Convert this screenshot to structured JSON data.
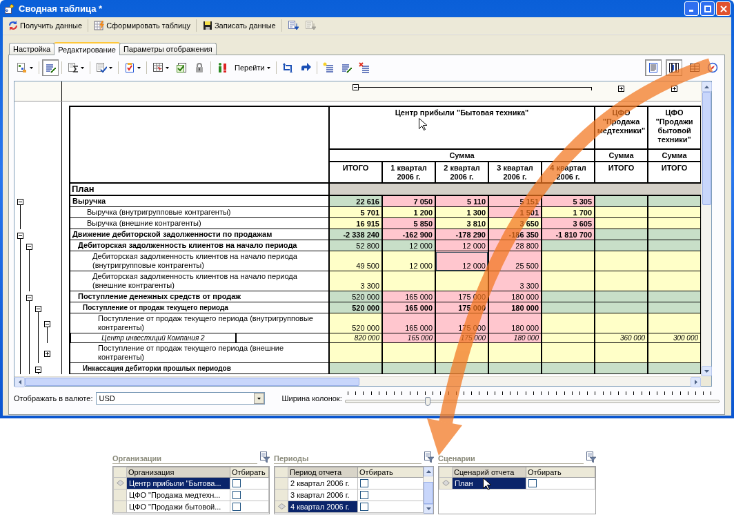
{
  "window": {
    "title": "Сводная таблица *"
  },
  "commands": [
    {
      "kind": "button",
      "label": "Получить данные"
    },
    {
      "kind": "button",
      "label": "Сформировать таблицу"
    },
    {
      "kind": "button",
      "label": "Записать данные"
    },
    {
      "kind": "icon",
      "disabled": false
    },
    {
      "kind": "icon",
      "disabled": true
    }
  ],
  "tabs": [
    {
      "label": "Настройка",
      "selected": false
    },
    {
      "label": "Редактирование",
      "selected": true
    },
    {
      "label": "Параметры отображения",
      "selected": false
    }
  ],
  "toolbar": [
    {
      "kind": "icon",
      "dropdown": true,
      "pressed": false
    },
    {
      "kind": "separator"
    },
    {
      "kind": "icon",
      "dropdown": false,
      "pressed": true
    },
    {
      "kind": "separator"
    },
    {
      "kind": "icon",
      "dropdown": true,
      "pressed": false
    },
    {
      "kind": "separator"
    },
    {
      "kind": "icon",
      "dropdown": true,
      "pressed": false
    },
    {
      "kind": "separator"
    },
    {
      "kind": "icon",
      "dropdown": true,
      "pressed": false
    },
    {
      "kind": "separator"
    },
    {
      "kind": "icon",
      "dropdown": true,
      "pressed": false
    },
    {
      "kind": "icon",
      "dropdown": false,
      "pressed": false
    },
    {
      "kind": "icon",
      "dropdown": false,
      "pressed": false
    },
    {
      "kind": "separator"
    },
    {
      "kind": "icon",
      "dropdown": false,
      "pressed": false
    },
    {
      "kind": "menu",
      "label": "Перейти"
    },
    {
      "kind": "separator"
    },
    {
      "kind": "icon",
      "dropdown": false,
      "pressed": false
    },
    {
      "kind": "icon",
      "dropdown": false,
      "pressed": false
    },
    {
      "kind": "separator"
    },
    {
      "kind": "icon",
      "dropdown": false,
      "pressed": false
    },
    {
      "kind": "icon",
      "dropdown": false,
      "pressed": false
    },
    {
      "kind": "icon",
      "dropdown": false,
      "pressed": false
    }
  ],
  "view_buttons": [
    {
      "pressed": true
    },
    {
      "pressed": true
    },
    {
      "pressed": false
    }
  ],
  "grid": {
    "header": {
      "groups": [
        {
          "title": "Центр прибыли \"Бытовая техника\"",
          "measure": "Сумма",
          "columns": [
            "ИТОГО",
            "1 квартал 2006 г.",
            "2 квартал 2006 г.",
            "3 квартал 2006 г.",
            "4 квартал 2006 г."
          ],
          "expanded": true
        },
        {
          "title": "ЦФО \"Продажа медтехники\"",
          "measure": "Сумма",
          "columns": [
            "ИТОГО"
          ],
          "expanded": false
        },
        {
          "title": "ЦФО \"Продажи бытовой техники\"",
          "measure": "Сумма",
          "columns": [
            "ИТОГО"
          ],
          "expanded": false
        }
      ]
    },
    "rows": [
      {
        "label": "План",
        "kind": "scenario"
      },
      {
        "label": "Выручка",
        "kind": "group",
        "bold_values": true,
        "expanded": true,
        "cells": [
          {
            "text": "22 616",
            "color": "#c8dfc8",
            "selected": false
          },
          {
            "text": "7 050",
            "color": "#ffc6ce",
            "selected": false
          },
          {
            "text": "5 110",
            "color": "#ffc6ce",
            "selected": false
          },
          {
            "text": "5 151",
            "color": "#ffc6ce",
            "selected": false
          },
          {
            "text": "5 305",
            "color": "#ffc6ce",
            "selected": false
          },
          {
            "color": "#c8dfc8",
            "selected": false
          },
          {
            "color": "#c8dfc8",
            "selected": false
          }
        ],
        "children": [
          {
            "label": "Выручка (внутригрупповые контрагенты)",
            "kind": "item",
            "bold_values": true,
            "cells": [
              {
                "text": "5 701",
                "color": "#ffffc8",
                "selected": false
              },
              {
                "text": "1 200",
                "color": "#ffffc8",
                "selected": false
              },
              {
                "text": "1 300",
                "color": "#ffffc8",
                "selected": false
              },
              {
                "text": "1 501",
                "color": "#ffc6ce",
                "selected": false
              },
              {
                "text": "1 700",
                "color": "#ffffc8",
                "selected": false
              },
              {
                "color": "#ffffc8",
                "selected": false
              },
              {
                "color": "#ffffc8",
                "selected": false
              }
            ]
          },
          {
            "label": "Выручка (внешние контрагенты)",
            "kind": "item",
            "bold_values": true,
            "cells": [
              {
                "text": "16 915",
                "color": "#ffffc8",
                "selected": false
              },
              {
                "text": "5 850",
                "color": "#ffc6ce",
                "selected": false
              },
              {
                "text": "3 810",
                "color": "#ffffc8",
                "selected": false
              },
              {
                "text": "3 650",
                "color": "#ffffc8",
                "selected": false
              },
              {
                "text": "3 605",
                "color": "#ffc6ce",
                "selected": false
              },
              {
                "color": "#ffffc8",
                "selected": false
              },
              {
                "color": "#ffffc8",
                "selected": false
              }
            ]
          }
        ]
      },
      {
        "label": "Движение дебиторской задолженности по продажам",
        "kind": "group",
        "bold_values": true,
        "expanded": true,
        "cells": [
          {
            "text": "-2 338 240",
            "color": "#c8dfc8",
            "selected": false
          },
          {
            "text": "-162 900",
            "color": "#ffc6ce",
            "selected": false
          },
          {
            "text": "-178 290",
            "color": "#ffc6ce",
            "selected": false
          },
          {
            "text": "-186 350",
            "color": "#ffc6ce",
            "selected": false
          },
          {
            "text": "-1 810 700",
            "color": "#ffc6ce",
            "selected": false
          },
          {
            "color": "#c8dfc8",
            "selected": false
          },
          {
            "color": "#c8dfc8",
            "selected": false
          }
        ],
        "children": [
          {
            "label": "Дебиторская задолженность клиентов на начало периода",
            "kind": "group",
            "bold_values": false,
            "expanded": true,
            "cells": [
              {
                "text": "52 800",
                "color": "#c8dfc8",
                "selected": false
              },
              {
                "text": "12 000",
                "color": "#c8dfc8",
                "selected": false
              },
              {
                "text": "12 000",
                "color": "#ffc6ce",
                "selected": false
              },
              {
                "text": "28 800",
                "color": "#ffc6ce",
                "selected": false
              },
              {
                "color": "#c8dfc8",
                "selected": false
              },
              {
                "color": "#c8dfc8",
                "selected": false
              },
              {
                "color": "#c8dfc8",
                "selected": false
              }
            ],
            "children": [
              {
                "label": "Дебиторская задолженность клиентов на начало периода (внутригрупповые контрагенты)",
                "kind": "item",
                "bold_values": false,
                "cells": [
                  {
                    "text": "49 500",
                    "color": "#ffffc8",
                    "selected": false
                  },
                  {
                    "text": "12 000",
                    "color": "#ffffc8",
                    "selected": false
                  },
                  {
                    "text": "12 000",
                    "color": "#ffc6ce",
                    "selected": true
                  },
                  {
                    "text": "25 500",
                    "color": "#ffc6ce",
                    "selected": false
                  },
                  {
                    "color": "#ffffc8",
                    "selected": false
                  },
                  {
                    "color": "#ffffc8",
                    "selected": false
                  },
                  {
                    "color": "#ffffc8",
                    "selected": false
                  }
                ]
              },
              {
                "label": "Дебиторская задолженность клиентов на начало периода (внешние контрагенты)",
                "kind": "item",
                "bold_values": false,
                "cells": [
                  {
                    "text": "3 300",
                    "color": "#ffffc8",
                    "selected": false
                  },
                  {
                    "color": "#ffffc8",
                    "selected": false
                  },
                  {
                    "color": "#ffffc8",
                    "selected": false
                  },
                  {
                    "text": "3 300",
                    "color": "#ffc6ce",
                    "selected": false
                  },
                  {
                    "color": "#ffffc8",
                    "selected": false
                  },
                  {
                    "color": "#ffffc8",
                    "selected": false
                  },
                  {
                    "color": "#ffffc8",
                    "selected": false
                  }
                ]
              }
            ]
          },
          {
            "label": "Поступление денежных средств от продаж",
            "kind": "group",
            "bold_values": false,
            "expanded": true,
            "cells": [
              {
                "text": "520 000",
                "color": "#c8dfc8",
                "selected": false
              },
              {
                "text": "165 000",
                "color": "#ffc6ce",
                "selected": false
              },
              {
                "text": "175 000",
                "color": "#ffc6ce",
                "selected": false
              },
              {
                "text": "180 000",
                "color": "#ffc6ce",
                "selected": false
              },
              {
                "color": "#c8dfc8",
                "selected": false
              },
              {
                "color": "#c8dfc8",
                "selected": false
              },
              {
                "color": "#c8dfc8",
                "selected": false
              }
            ],
            "children": [
              {
                "label": "Поступление от продаж текущего периода",
                "kind": "subgroup",
                "bold_values": true,
                "expanded": true,
                "cells": [
                  {
                    "text": "520 000",
                    "color": "#c8dfc8",
                    "selected": false
                  },
                  {
                    "text": "165 000",
                    "color": "#ffc6ce",
                    "selected": false
                  },
                  {
                    "text": "175 000",
                    "color": "#ffc6ce",
                    "selected": false
                  },
                  {
                    "text": "180 000",
                    "color": "#ffc6ce",
                    "selected": false
                  },
                  {
                    "color": "#c8dfc8",
                    "selected": false
                  },
                  {
                    "color": "#c8dfc8",
                    "selected": false
                  },
                  {
                    "color": "#c8dfc8",
                    "selected": false
                  }
                ],
                "children": [
                  {
                    "label": "Поступление от продаж текущего периода (внутригрупповые контрагенты)",
                    "kind": "item",
                    "bold_values": false,
                    "expanded": true,
                    "cells": [
                      {
                        "text": "520 000",
                        "color": "#ffffc8",
                        "selected": false
                      },
                      {
                        "text": "165 000",
                        "color": "#ffc6ce",
                        "selected": false
                      },
                      {
                        "text": "175 000",
                        "color": "#ffc6ce",
                        "selected": false
                      },
                      {
                        "text": "180 000",
                        "color": "#ffc6ce",
                        "selected": false
                      },
                      {
                        "color": "#ffffc8",
                        "selected": false
                      },
                      {
                        "color": "#ffffc8",
                        "selected": false
                      },
                      {
                        "color": "#ffffc8",
                        "selected": false
                      }
                    ],
                    "children": [
                      {
                        "label": "Центр инвестиций Компания 2",
                        "kind": "analytic",
                        "bold_values": false,
                        "cells": [
                          {
                            "text": "820 000",
                            "color": "#ffffc8",
                            "selected": false
                          },
                          {
                            "text": "165 000",
                            "color": "#ffc6ce",
                            "selected": false
                          },
                          {
                            "text": "175 000",
                            "color": "#ffc6ce",
                            "selected": false
                          },
                          {
                            "text": "180 000",
                            "color": "#ffc6ce",
                            "selected": false
                          },
                          {
                            "color": "#ffffc8",
                            "selected": false
                          },
                          {
                            "text": "360 000",
                            "color": "#ffffc8",
                            "selected": false
                          },
                          {
                            "text": "300 000",
                            "color": "#ffffc8",
                            "selected": false
                          }
                        ]
                      }
                    ]
                  },
                  {
                    "label": "Поступление от продаж текущего периода (внешние контрагенты)",
                    "kind": "item",
                    "expanded": false,
                    "cells": [
                      {
                        "color": "#ffffc8",
                        "selected": false
                      },
                      {
                        "color": "#ffffc8",
                        "selected": false
                      },
                      {
                        "color": "#ffffc8",
                        "selected": false
                      },
                      {
                        "color": "#ffffc8",
                        "selected": false
                      },
                      {
                        "color": "#ffffc8",
                        "selected": false
                      },
                      {
                        "color": "#ffffc8",
                        "selected": false
                      },
                      {
                        "color": "#ffffc8",
                        "selected": false
                      }
                    ]
                  }
                ]
              },
              {
                "label": "Инкассация дебиторки прошлых периодов",
                "kind": "subgroup",
                "expanded": true,
                "cells": [
                  {
                    "color": "#c8dfc8",
                    "selected": false
                  },
                  {
                    "color": "#c8dfc8",
                    "selected": false
                  },
                  {
                    "color": "#c8dfc8",
                    "selected": false
                  },
                  {
                    "color": "#c8dfc8",
                    "selected": false
                  },
                  {
                    "color": "#c8dfc8",
                    "selected": false
                  },
                  {
                    "color": "#c8dfc8",
                    "selected": false
                  },
                  {
                    "color": "#c8dfc8",
                    "selected": false
                  }
                ]
              }
            ]
          }
        ]
      }
    ]
  },
  "footer": {
    "currency_label": "Отображать в валюте:",
    "currency": "USD",
    "width_label": "Ширина колонок:",
    "width": {
      "level": 0.22
    }
  },
  "filters": [
    {
      "title": "Организации",
      "columns": [
        "Организация",
        "Отбирать"
      ],
      "scrollbar": false,
      "rows": [
        {
          "text": "Центр прибыли \"Бытова...",
          "selected": true,
          "checked": false
        },
        {
          "text": "ЦФО \"Продажа медтехн...",
          "selected": false,
          "checked": false
        },
        {
          "text": "ЦФО \"Продажи бытовой...",
          "selected": false,
          "checked": false
        }
      ]
    },
    {
      "title": "Периоды",
      "columns": [
        "Период отчета",
        "Отбирать"
      ],
      "scrollbar": true,
      "rows": [
        {
          "text": "2 квартал 2006 г.",
          "selected": false,
          "checked": false
        },
        {
          "text": "3 квартал 2006 г.",
          "selected": false,
          "checked": false
        },
        {
          "text": "4 квартал 2006 г.",
          "selected": true,
          "checked": false
        }
      ]
    },
    {
      "title": "Сценарии",
      "columns": [
        "Сценарий отчета",
        "Отбирать"
      ],
      "scrollbar": false,
      "rows": [
        {
          "text": "План",
          "selected": true,
          "checked": false
        }
      ]
    }
  ]
}
